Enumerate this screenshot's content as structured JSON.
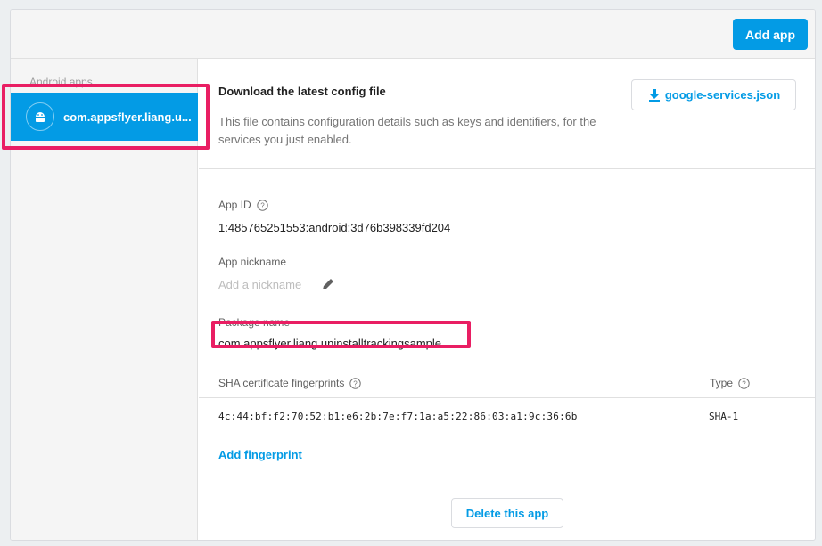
{
  "header": {
    "add_app_label": "Add app"
  },
  "sidebar": {
    "heading": "Android apps",
    "selected_app": {
      "label": "com.appsflyer.liang.u...",
      "icon": "android-icon"
    }
  },
  "config": {
    "title": "Download the latest config file",
    "description": "This file contains configuration details such as keys and identifiers, for the services you just enabled.",
    "download_label": "google-services.json",
    "download_icon": "download-icon"
  },
  "app_id": {
    "label": "App ID",
    "value": "1:485765251553:android:3d76b398339fd204"
  },
  "nickname": {
    "label": "App nickname",
    "placeholder": "Add a nickname"
  },
  "package": {
    "label": "Package name",
    "value": "com.appsflyer.liang.uninstalltrackingsample"
  },
  "sha": {
    "label": "SHA certificate fingerprints",
    "type_label": "Type",
    "fingerprint": "4c:44:bf:f2:70:52:b1:e6:2b:7e:f7:1a:a5:22:86:03:a1:9c:36:6b",
    "type": "SHA-1",
    "add_label": "Add fingerprint"
  },
  "delete_label": "Delete this app",
  "colors": {
    "accent": "#039be5",
    "highlight": "#e91e63"
  }
}
